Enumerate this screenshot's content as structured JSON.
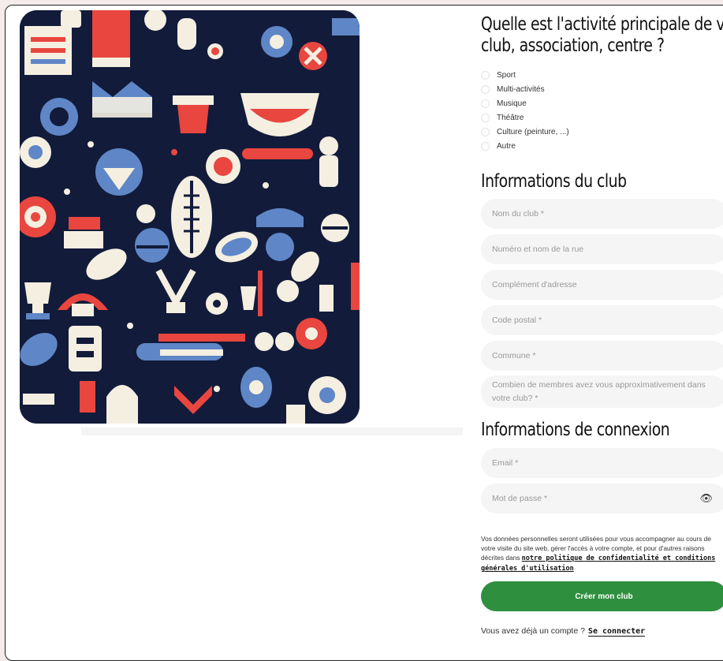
{
  "activity": {
    "title_line1": "Quelle est l'activité principale de votre",
    "title_line2": "club, association, centre ?",
    "options": [
      "Sport",
      "Multi-activités",
      "Musique",
      "Théâtre",
      "Culture (peinture, ...)",
      "Autre"
    ]
  },
  "club_info": {
    "title": "Informations du club",
    "club_name_placeholder": "Nom du club *",
    "street_placeholder": "Numéro et nom de la rue",
    "address_complement_placeholder": "Complément d'adresse",
    "postal_code_placeholder": "Code postal *",
    "city_placeholder": "Commune *",
    "members_placeholder": "Combien de membres avez vous approximativement dans votre club? *"
  },
  "login_info": {
    "title": "Informations de connexion",
    "email_placeholder": "Email *",
    "password_placeholder": "Mot de passe *",
    "show_password_icon": "eye-icon"
  },
  "legal": {
    "text": "Vos données personnelles seront utilisées pour vous accompagner au cours de votre visite du site web, gérer l'accès à votre compte, et pour d'autres raisons décrites dans",
    "link": "notre politique de confidentialité et conditions générales d'utilisation"
  },
  "cta": {
    "label": "Créer mon club",
    "color": "#2e8f3e"
  },
  "footer": {
    "question": "Vous avez déjà un compte ?",
    "link": "Se connecter"
  },
  "colors": {
    "illustration_bg": "#121b3a",
    "red": "#e8463f",
    "blue": "#5f86c6",
    "cream": "#f4efe1"
  }
}
